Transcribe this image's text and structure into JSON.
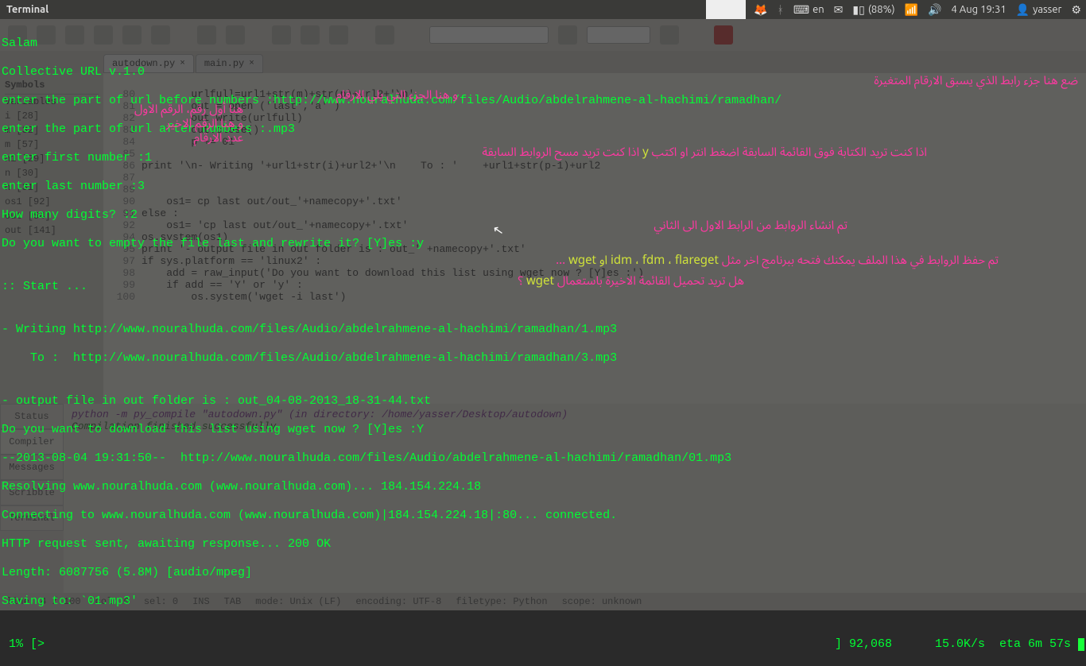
{
  "panel": {
    "title": "Terminal",
    "lang": "en",
    "battery": "(88%)",
    "time": "4 Aug 19:31",
    "user": "yasser"
  },
  "tabs": {
    "0": {
      "label": "autodown.py"
    },
    "1": {
      "label": "main.py"
    }
  },
  "sidebar": {
    "title": "Symbols",
    "items": {
      "0": "Variables",
      "1": "i [28]",
      "2": "m [32]",
      "3": "m [57]",
      "4": "n1 [29]",
      "5": "n [30]",
      "6": "n [31]",
      "7": "os1 [92]",
      "8": "out [54]",
      "9": "out [141]"
    }
  },
  "code": {
    "80": "        urlfull=url1+str(m)+str(p)+url2+'\\n'",
    "81": "        out = open ('last','a' )",
    "82": "        out.write(urlfull)",
    "83": "        out.close()",
    "84": "        p += 01",
    "85": "",
    "86": "print '\\n- Writing '+url1+str(i)+url2+'\\n    To : '    +url1+str(p-1)+url2",
    "87": "",
    "89": "",
    "90": "    os1= cp last out/out_'+namecopy+'.txt'",
    "91": "else :",
    "92": "    os1= 'cp last out/out_'+namecopy+'.txt'",
    "94": "os.system(os1)",
    "95": "print '- output file in out folder is : out_' +namecopy+'.txt'",
    "97": "if sys.platform == 'linux2' :",
    "98": "    add = raw_input('Do you want to download this list using wget now ? [Y]es :')",
    "99": "    if add == 'Y' or 'y' :",
    "100": "        os.system('wget -i last')"
  },
  "term": {
    "l0": "Salam",
    "l1": "Collective URL v.1.0",
    "l2": "enter the part of url before numbers :http://www.nouralhuda.com/files/Audio/abdelrahmene-al-hachimi/ramadhan/",
    "l3": "enter the part of url after numbers :.mp3",
    "l4": "enter first number :1",
    "l5": "enter last number :3",
    "l6": "How many digits? :2",
    "l7": "Do you want to empty the file last and rewrite it? [Y]es :y",
    "l8": "",
    "l9": ":: Start ...",
    "l10": "",
    "l11": "- Writing http://www.nouralhuda.com/files/Audio/abdelrahmene-al-hachimi/ramadhan/1.mp3",
    "l12": "    To :  http://www.nouralhuda.com/files/Audio/abdelrahmene-al-hachimi/ramadhan/3.mp3",
    "l13": "",
    "l14": "- output file in out folder is : out_04-08-2013_18-31-44.txt",
    "l15": "Do you want to download this list using wget now ? [Y]es :Y",
    "l16": "--2013-08-04 19:31:50--  http://www.nouralhuda.com/files/Audio/abdelrahmene-al-hachimi/ramadhan/01.mp3",
    "l17": "Resolving www.nouralhuda.com (www.nouralhuda.com)... 184.154.224.18",
    "l18": "Connecting to www.nouralhuda.com (www.nouralhuda.com)|184.154.224.18|:80... connected.",
    "l19": "HTTP request sent, awaiting response... 200 OK",
    "l20": "Length: 6087756 (5.8M) [audio/mpeg]",
    "l21": "Saving to: `01.mp3'",
    "l22": "",
    "prog_left": " 1% [>",
    "prog_right": "] 92,068      15.0K/s  eta 6m 57s "
  },
  "arabic": {
    "a0": "ضع هنا جزء رابط الذي يسبق الارقام المتغيرة",
    "a1": "و هنا الجزء التي يلي الارقام",
    "a2": "هنا أول رقم، الرقم الاول",
    "a3": "و هنا الرقم الاخير",
    "a4": "عدد الارقام",
    "a5_pre": "اذا كنت تريد الكتابة فوق القائمة السابقة اضغط انتر او اكتب",
    "a5_y": " y ",
    "a5_post": "اذا كنت تريد مسح الروابط السابقة",
    "a6": "تم انشاء الروابط من الرابط الاول الى الثاني",
    "a7_pre": "تم حفظ الروابط في هذا الملف يمكنك فتحه ببرنامج اخر مثل",
    "a7_tools": " idm ، fdm ، flareget او wget ",
    "a7_post": "...",
    "a8_pre": "هل تريد تحميل القائمة الاخيرة باستعمال",
    "a8_tool": " wget ",
    "a8_post": "؟"
  },
  "compiler": {
    "cmd": "python -m py_compile \"autodown.py\" (in directory: /home/yasser/Desktop/autodown)",
    "ok": "Compilation finished successfully."
  },
  "bottabs": {
    "0": "Status",
    "1": "Compiler",
    "2": "Messages",
    "3": "Scribble",
    "4": "Terminal"
  },
  "status": {
    "line": "line: 4 / 100",
    "col": "col: 0",
    "sel": "sel: 0",
    "ins": "INS",
    "tab": "TAB",
    "mode": "mode: Unix (LF)",
    "enc": "encoding: UTF-8",
    "ft": "filetype: Python",
    "scope": "scope: unknown"
  }
}
